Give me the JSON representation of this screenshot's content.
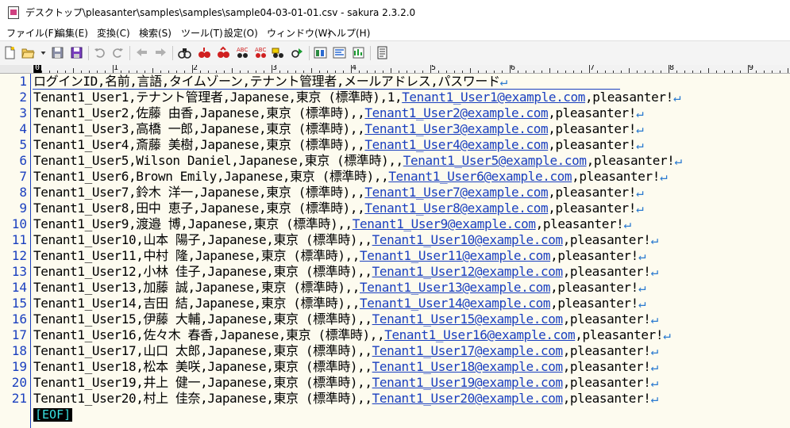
{
  "window": {
    "title": "デスクトップ\\pleasanter\\samples\\samples\\sample04-03-01-01.csv - sakura 2.3.2.0"
  },
  "menu": [
    "ファイル(F)",
    "編集(E)",
    "変換(C)",
    "検索(S)",
    "ツール(T)",
    "設定(O)",
    "ウィンドウ(W)",
    "ヘルプ(H)"
  ],
  "toolbar": {
    "icons": [
      "new-file-icon",
      "open-file-icon",
      "open-dropdown-icon",
      "save-icon",
      "save-all-icon",
      "undo-icon",
      "redo-icon",
      "back-icon",
      "forward-icon",
      "search-icon",
      "search-next-icon",
      "search-prev-icon",
      "replace-icon",
      "mark-icon",
      "tag-jump-icon",
      "grep-icon",
      "compare-icon",
      "outline-icon",
      "settings-icon"
    ]
  },
  "ruler": {
    "labels": [
      "0",
      "1",
      "2",
      "3",
      "4",
      "5",
      "6",
      "7",
      "8",
      "9"
    ]
  },
  "editor": {
    "eol_mark": "↵",
    "eof_label": "[EOF]",
    "lines": [
      {
        "n": "1",
        "text": "ログインID,名前,言語,タイムゾーン,テナント管理者,メールアドレス,パスワード",
        "email": "",
        "tail": ""
      },
      {
        "n": "2",
        "text": "Tenant1_User1,テナント管理者,Japanese,東京 (標準時),1,",
        "email": "Tenant1_User1@example.com",
        "tail": ",pleasanter!"
      },
      {
        "n": "3",
        "text": "Tenant1_User2,佐藤 由香,Japanese,東京 (標準時),,",
        "email": "Tenant1_User2@example.com",
        "tail": ",pleasanter!"
      },
      {
        "n": "4",
        "text": "Tenant1_User3,高橋 一郎,Japanese,東京 (標準時),,",
        "email": "Tenant1_User3@example.com",
        "tail": ",pleasanter!"
      },
      {
        "n": "5",
        "text": "Tenant1_User4,斎藤 美樹,Japanese,東京 (標準時),,",
        "email": "Tenant1_User4@example.com",
        "tail": ",pleasanter!"
      },
      {
        "n": "6",
        "text": "Tenant1_User5,Wilson Daniel,Japanese,東京 (標準時),,",
        "email": "Tenant1_User5@example.com",
        "tail": ",pleasanter!"
      },
      {
        "n": "7",
        "text": "Tenant1_User6,Brown Emily,Japanese,東京 (標準時),,",
        "email": "Tenant1_User6@example.com",
        "tail": ",pleasanter!"
      },
      {
        "n": "8",
        "text": "Tenant1_User7,鈴木 洋一,Japanese,東京 (標準時),,",
        "email": "Tenant1_User7@example.com",
        "tail": ",pleasanter!"
      },
      {
        "n": "9",
        "text": "Tenant1_User8,田中 恵子,Japanese,東京 (標準時),,",
        "email": "Tenant1_User8@example.com",
        "tail": ",pleasanter!"
      },
      {
        "n": "10",
        "text": "Tenant1_User9,渡邉 博,Japanese,東京 (標準時),,",
        "email": "Tenant1_User9@example.com",
        "tail": ",pleasanter!"
      },
      {
        "n": "11",
        "text": "Tenant1_User10,山本 陽子,Japanese,東京 (標準時),,",
        "email": "Tenant1_User10@example.com",
        "tail": ",pleasanter!"
      },
      {
        "n": "12",
        "text": "Tenant1_User11,中村 隆,Japanese,東京 (標準時),,",
        "email": "Tenant1_User11@example.com",
        "tail": ",pleasanter!"
      },
      {
        "n": "13",
        "text": "Tenant1_User12,小林 佳子,Japanese,東京 (標準時),,",
        "email": "Tenant1_User12@example.com",
        "tail": ",pleasanter!"
      },
      {
        "n": "14",
        "text": "Tenant1_User13,加藤 誠,Japanese,東京 (標準時),,",
        "email": "Tenant1_User13@example.com",
        "tail": ",pleasanter!"
      },
      {
        "n": "15",
        "text": "Tenant1_User14,吉田 結,Japanese,東京 (標準時),,",
        "email": "Tenant1_User14@example.com",
        "tail": ",pleasanter!"
      },
      {
        "n": "16",
        "text": "Tenant1_User15,伊藤 大輔,Japanese,東京 (標準時),,",
        "email": "Tenant1_User15@example.com",
        "tail": ",pleasanter!"
      },
      {
        "n": "17",
        "text": "Tenant1_User16,佐々木 春香,Japanese,東京 (標準時),,",
        "email": "Tenant1_User16@example.com",
        "tail": ",pleasanter!"
      },
      {
        "n": "18",
        "text": "Tenant1_User17,山口 太郎,Japanese,東京 (標準時),,",
        "email": "Tenant1_User17@example.com",
        "tail": ",pleasanter!"
      },
      {
        "n": "19",
        "text": "Tenant1_User18,松本 美咲,Japanese,東京 (標準時),,",
        "email": "Tenant1_User18@example.com",
        "tail": ",pleasanter!"
      },
      {
        "n": "20",
        "text": "Tenant1_User19,井上 健一,Japanese,東京 (標準時),,",
        "email": "Tenant1_User19@example.com",
        "tail": ",pleasanter!"
      },
      {
        "n": "21",
        "text": "Tenant1_User20,村上 佳奈,Japanese,東京 (標準時),,",
        "email": "Tenant1_User20@example.com",
        "tail": ",pleasanter!"
      }
    ]
  }
}
